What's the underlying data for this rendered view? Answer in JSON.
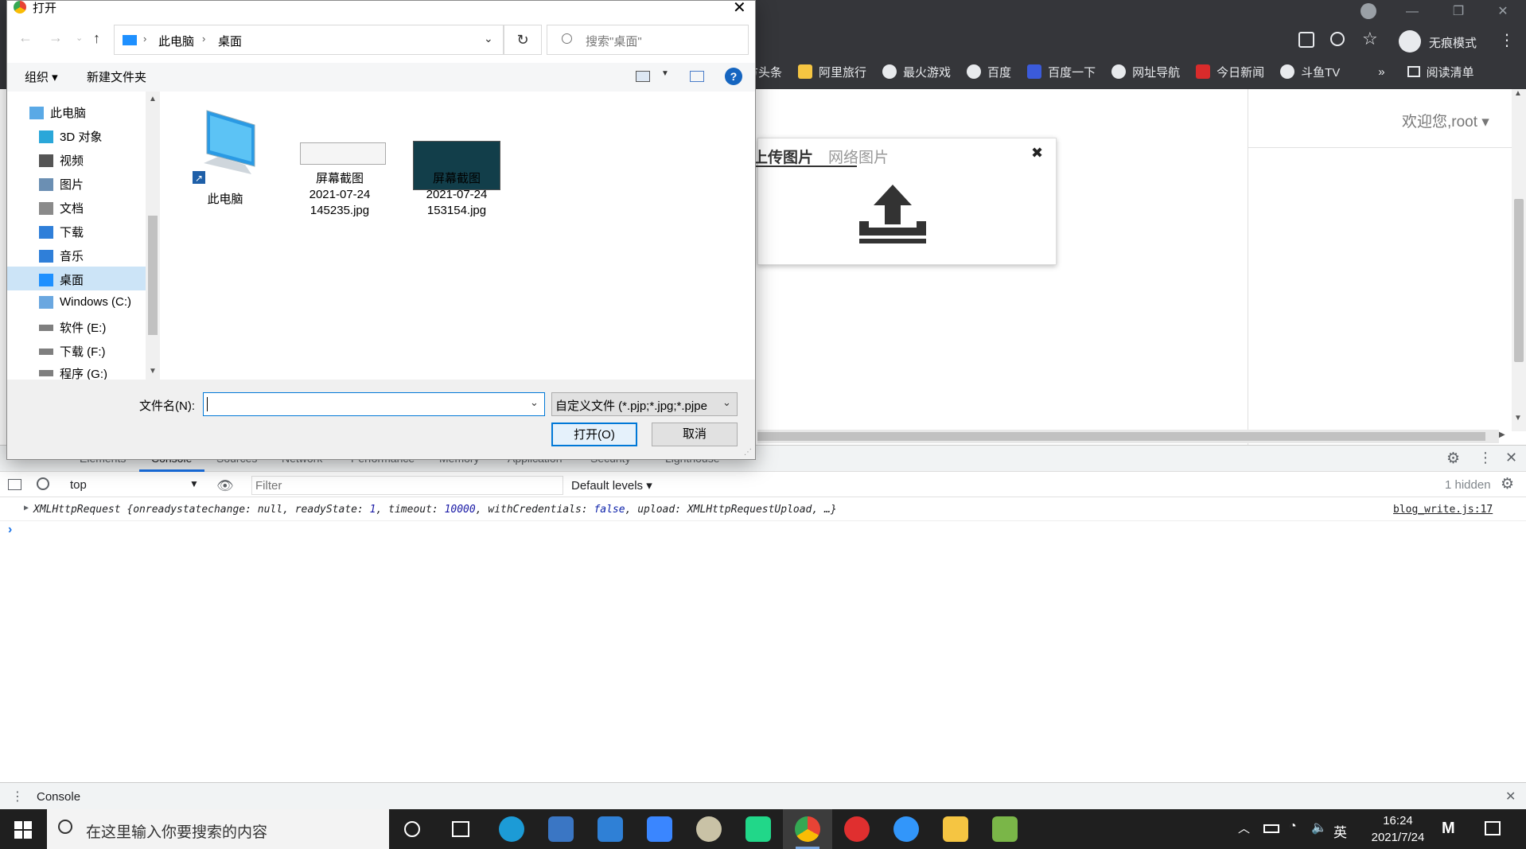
{
  "browser": {
    "mode_label": "无痕模式",
    "reading_list": "阅读清单",
    "bookmarks": [
      "方头条",
      "阿里旅行",
      "最火游戏",
      "百度",
      "百度一下",
      "网址导航",
      "今日新闻",
      "斗鱼TV"
    ],
    "more": "»"
  },
  "page": {
    "welcome": "欢迎您,root",
    "upload_tabs": [
      "上传图片",
      "网络图片"
    ],
    "close": "✖"
  },
  "devtools": {
    "tabs": [
      "Elements",
      "Console",
      "Sources",
      "Network",
      "Performance",
      "Memory",
      "Application",
      "Security",
      "Lighthouse"
    ],
    "context": "top",
    "filter_placeholder": "Filter",
    "levels": "Default levels",
    "hidden": "1 hidden",
    "log": {
      "prefix": "XMLHttpRequest ",
      "body_a": "{onreadystatechange: null, readyState: ",
      "ready": "1",
      "body_b": ", timeout: ",
      "timeout": "10000",
      "body_c": ", withCredentials: ",
      "cred": "false",
      "body_d": ", upload: XMLHttpRequestUpload, …}",
      "source": "blog_write.js:17"
    },
    "prompt": "›",
    "drawer_label": "Console"
  },
  "dialog": {
    "title": "打开",
    "breadcrumb": [
      "此电脑",
      "桌面"
    ],
    "search_placeholder": "搜索\"桌面\"",
    "organize": "组织",
    "new_folder": "新建文件夹",
    "help": "?",
    "nav": [
      {
        "label": "此电脑",
        "color": "#5aa9e6"
      },
      {
        "label": "3D 对象",
        "color": "#2aa7d9"
      },
      {
        "label": "视频",
        "color": "#555555"
      },
      {
        "label": "图片",
        "color": "#6b8fb3"
      },
      {
        "label": "文档",
        "color": "#8a8a8a"
      },
      {
        "label": "下载",
        "color": "#2f7fd9"
      },
      {
        "label": "音乐",
        "color": "#2f7fd9"
      },
      {
        "label": "桌面",
        "color": "#1e90ff"
      },
      {
        "label": "Windows (C:)",
        "color": "#6aa7e0"
      },
      {
        "label": "软件 (E:)",
        "color": "#7f7f7f"
      },
      {
        "label": "下载 (F:)",
        "color": "#7f7f7f"
      },
      {
        "label": "程序 (G:)",
        "color": "#7f7f7f"
      }
    ],
    "selected_nav": "桌面",
    "files": [
      {
        "name": "此电脑",
        "name2": "",
        "name3": ""
      },
      {
        "name": "屏幕截图",
        "name2": "2021-07-24",
        "name3": "145235.jpg"
      },
      {
        "name": "屏幕截图",
        "name2": "2021-07-24",
        "name3": "153154.jpg"
      }
    ],
    "filename_label": "文件名(N):",
    "filename_value": "",
    "filter_type": "自定义文件 (*.pjp;*.jpg;*.pjpe",
    "open_button": "打开(O)",
    "cancel_button": "取消"
  },
  "taskbar": {
    "search_placeholder": "在这里输入你要搜索的内容",
    "time": "16:24",
    "date": "2021/7/24",
    "ime": "英",
    "apps": [
      {
        "name": "edge",
        "color": "#1c9bd6"
      },
      {
        "name": "store",
        "color": "#3a76c4"
      },
      {
        "name": "mail",
        "color": "#2f80d6"
      },
      {
        "name": "feishu",
        "color": "#3a86ff"
      },
      {
        "name": "paint",
        "color": "#c9c2a6"
      },
      {
        "name": "pycharm",
        "color": "#21d789"
      },
      {
        "name": "chrome",
        "color": "#e84335"
      },
      {
        "name": "netease-music",
        "color": "#e02f2f"
      },
      {
        "name": "dingtalk",
        "color": "#3296fa"
      },
      {
        "name": "explorer",
        "color": "#f5c542"
      },
      {
        "name": "notepad",
        "color": "#7ab648"
      }
    ]
  }
}
